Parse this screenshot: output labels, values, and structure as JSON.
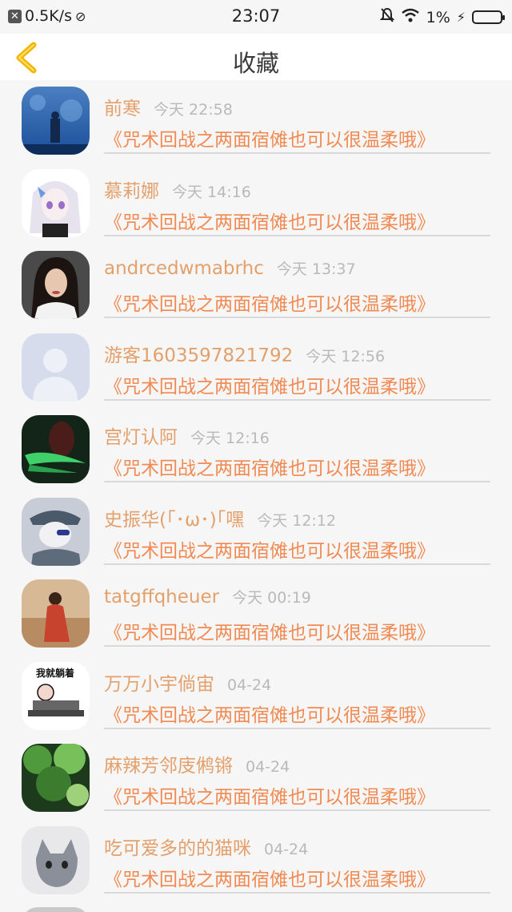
{
  "status_bar": {
    "net_speed": "0.5K/s",
    "time": "23:07",
    "battery": "1%"
  },
  "header": {
    "title": "收藏"
  },
  "items": [
    {
      "user": "前寒",
      "time": "今天 22:58",
      "title": "《咒术回战之两面宿傩也可以很温柔哦》",
      "avatar": "blue-figure"
    },
    {
      "user": "慕莉娜",
      "time": "今天 14:16",
      "title": "《咒术回战之两面宿傩也可以很温柔哦》",
      "avatar": "anime-girl"
    },
    {
      "user": "andrcedwmabrhc",
      "time": "今天 13:37",
      "title": "《咒术回战之两面宿傩也可以很温柔哦》",
      "avatar": "woman-portrait"
    },
    {
      "user": "游客1603597821792",
      "time": "今天 12:56",
      "title": "《咒术回战之两面宿傩也可以很温柔哦》",
      "avatar": "default-user"
    },
    {
      "user": "宫灯认阿",
      "time": "今天 12:16",
      "title": "《咒术回战之两面宿傩也可以很温柔哦》",
      "avatar": "green-warrior"
    },
    {
      "user": "史振华(｢･ω･)｢嘿",
      "time": "今天 12:12",
      "title": "《咒术回战之两面宿傩也可以很温柔哦》",
      "avatar": "anime-cap"
    },
    {
      "user": "tatgffqheuer",
      "time": "今天 00:19",
      "title": "《咒术回战之两面宿傩也可以很温柔哦》",
      "avatar": "desert-woman"
    },
    {
      "user": "万万小宇倘宙",
      "time": "04-24",
      "title": "《咒术回战之两面宿傩也可以很温柔哦》",
      "avatar": "meme-bed",
      "avatar_text": "我就躺着"
    },
    {
      "user": "麻辣芳邻庋鸺锵",
      "time": "04-24",
      "title": "《咒术回战之两面宿傩也可以很温柔哦》",
      "avatar": "forest"
    },
    {
      "user": "吃可爱多的的猫咪",
      "time": "04-24",
      "title": "《咒术回战之两面宿傩也可以很温柔哦》",
      "avatar": "grey-cat"
    }
  ],
  "colors": {
    "username": "#e3a06b",
    "title": "#f08a52",
    "time": "#b9b9b9",
    "back_arrow": "#f2b600"
  }
}
